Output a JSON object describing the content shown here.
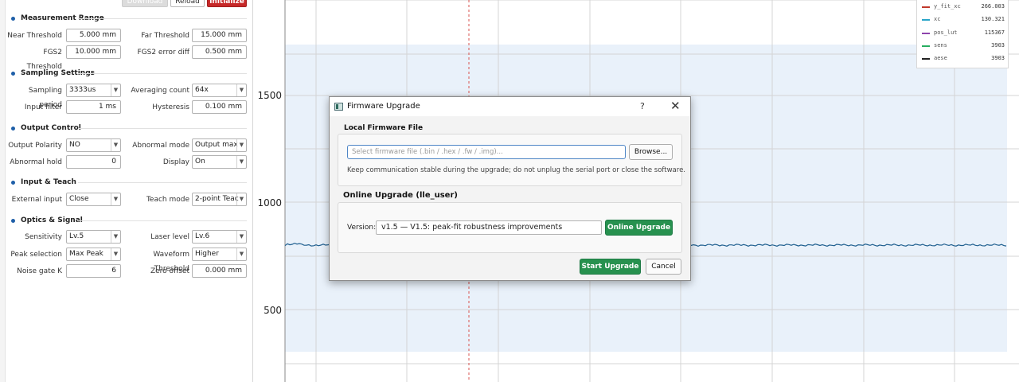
{
  "toolbar": {
    "download_label": "Download",
    "reload_label": "Reload",
    "initialize_label": "Initialize"
  },
  "sections": {
    "measurement": "Measurement Range",
    "sampling": "Sampling Settings",
    "output": "Output Control",
    "input": "Input & Teach",
    "optics": "Optics & Signal"
  },
  "fields": {
    "near_threshold": {
      "label": "Near Threshold",
      "value": "5.000 mm"
    },
    "far_threshold": {
      "label": "Far Threshold",
      "value": "15.000 mm"
    },
    "fgs2_threshold": {
      "label": "FGS2 Threshold",
      "value": "10.000 mm"
    },
    "fgs2_error_diff": {
      "label": "FGS2 error diff",
      "value": "0.500 mm"
    },
    "sampling_period": {
      "label": "Sampling period",
      "value": "3333us"
    },
    "averaging_count": {
      "label": "Averaging count",
      "value": "64x"
    },
    "input_filter": {
      "label": "Input filter",
      "value": "1 ms"
    },
    "hysteresis": {
      "label": "Hysteresis",
      "value": "0.100 mm"
    },
    "output_polarity": {
      "label": "Output Polarity",
      "value": "NO"
    },
    "abnormal_mode": {
      "label": "Abnormal mode",
      "value": "Output max"
    },
    "abnormal_hold": {
      "label": "Abnormal hold",
      "value": "0"
    },
    "display": {
      "label": "Display",
      "value": "On"
    },
    "external_input": {
      "label": "External input",
      "value": "Close"
    },
    "teach_mode": {
      "label": "Teach mode",
      "value": "2-point Teac"
    },
    "sensitivity": {
      "label": "Sensitivity",
      "value": "Lv.5"
    },
    "laser_level": {
      "label": "Laser level",
      "value": "Lv.6"
    },
    "peak_selection": {
      "label": "Peak selection",
      "value": "Max Peak"
    },
    "waveform_threshold": {
      "label": "Waveform Threshold",
      "value": "Higher"
    },
    "noise_gate_k": {
      "label": "Noise gate K",
      "value": "6"
    },
    "zero_offset": {
      "label": "Zero offset",
      "value": "0.000 mm"
    }
  },
  "chart": {
    "y_ticks": [
      "1500",
      "1000",
      "500"
    ],
    "line_color": "#1f5f8f",
    "marker_color": "#d9534f",
    "band_color": "#e9f1fa"
  },
  "legend": [
    {
      "name": "y_fit_xc",
      "value": "266.003",
      "color": "#c0392b"
    },
    {
      "name": "xc",
      "value": "130.321",
      "color": "#2aa5c9"
    },
    {
      "name": "pos_lut",
      "value": "115367",
      "color": "#8e44ad"
    },
    {
      "name": "sens",
      "value": "3903",
      "color": "#27ae60"
    },
    {
      "name": "aese",
      "value": "3903",
      "color": "#222222"
    }
  ],
  "dialog": {
    "title": "Firmware Upgrade",
    "help": "?",
    "close": "✕",
    "local_title": "Local Firmware File",
    "file_placeholder": "Select firmware file (.bin / .hex / .fw / .img)...",
    "browse_label": "Browse...",
    "note": "Keep communication stable during the upgrade; do not unplug the serial port or close the software.",
    "online_title": "Online Upgrade (lle_user)",
    "version_label": "Version:",
    "version_value": "v1.5  —  V1.5: peak-fit robustness improvements",
    "online_upgrade_label": "Online Upgrade",
    "start_upgrade_label": "Start Upgrade",
    "cancel_label": "Cancel"
  }
}
